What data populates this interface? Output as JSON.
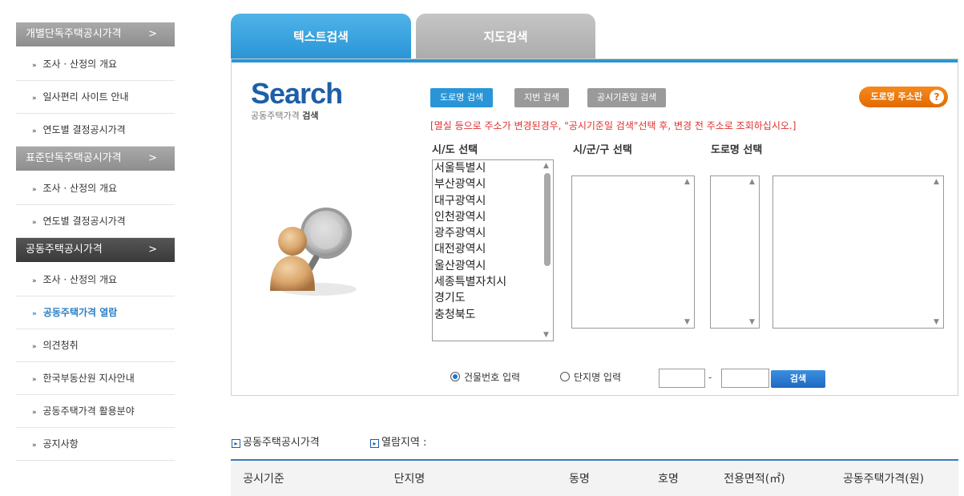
{
  "sidebar": {
    "sections": [
      {
        "title": "개별단독주택공시가격",
        "items": [
          "조사 · 산정의 개요",
          "일사편리 사이트 안내",
          "연도별 결정공시가격"
        ]
      },
      {
        "title": "표준단독주택공시가격",
        "items": [
          "조사 · 산정의 개요",
          "연도별 결정공시가격"
        ]
      },
      {
        "title": "공동주택공시가격",
        "items": [
          "조사 · 산정의 개요",
          "공동주택가격 열람",
          "의견청취",
          "한국부동산원 지사안내",
          "공동주택가격 활용분야",
          "공지사항"
        ]
      }
    ],
    "chevron": ">",
    "bullet": "»"
  },
  "tabs": {
    "text_search": "텍스트검색",
    "map_search": "지도검색"
  },
  "search": {
    "brand_big": "Search",
    "brand_small_prefix": "공동주택가격 ",
    "brand_small_bold": "검색",
    "btn_road": "도로명 검색",
    "btn_jibun": "지번 검색",
    "btn_notice": "공시기준일 검색",
    "btn_help": "도로명 주소란",
    "help_icon": "?",
    "notice": "[멸실 등으로 주소가 변경된경우, \"공시기준일 검색\"선택 후, 변경 전 주소로 조회하십시오.]",
    "label_sido": "시/도 선택",
    "label_sigungu": "시/군/구 선택",
    "label_road": "도로명 선택",
    "sido_options": [
      "서울특별시",
      "부산광역시",
      "대구광역시",
      "인천광역시",
      "광주광역시",
      "대전광역시",
      "울산광역시",
      "세종특별자치시",
      "경기도",
      "충청북도"
    ],
    "radio_building": "건물번호 입력",
    "radio_complex": "단지명 입력",
    "dash": "-",
    "btn_search": "검색"
  },
  "results": {
    "price_label": "공동주택공시가격",
    "region_label": "열람지역 :",
    "columns": [
      "공시기준",
      "단지명",
      "동명",
      "호명",
      "전용면적(㎡)",
      "공동주택가격(원)"
    ]
  }
}
